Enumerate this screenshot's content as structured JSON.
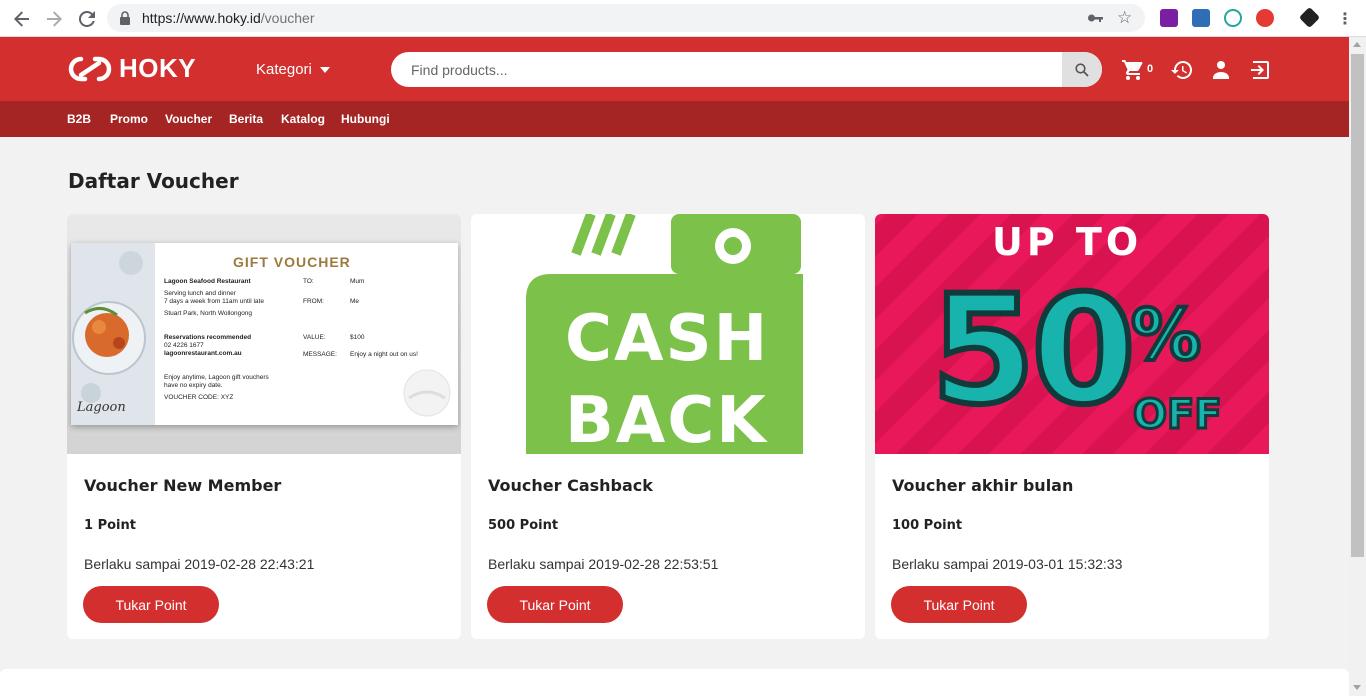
{
  "browser": {
    "url_domain": "https://www.hoky.id",
    "url_path": "/voucher",
    "back_icon": "back-arrow-icon",
    "forward_icon": "forward-arrow-icon",
    "reload_icon": "reload-icon"
  },
  "header": {
    "logo_text": "HOKY",
    "kategori_label": "Kategori",
    "search_placeholder": "Find products...",
    "cart_count": "0",
    "brand_color": "#d32f2f",
    "subnav_color": "#a52525"
  },
  "subnav": {
    "items": [
      "B2B",
      "Promo",
      "Voucher",
      "Berita",
      "Katalog",
      "Hubungi"
    ]
  },
  "main": {
    "page_title": "Daftar Voucher",
    "vouchers": [
      {
        "title": "Voucher New Member",
        "points": "1 Point",
        "validity": "Berlaku sampai 2019-02-28 22:43:21",
        "button_label": "Tukar Point",
        "image": {
          "heading": "GIFT VOUCHER",
          "restaurant": "Lagoon Seafood Restaurant",
          "hours_1": "Serving lunch and dinner",
          "hours_2": "7 days a week from 11am until late",
          "address": "Stuart Park, North Wollongong",
          "reservations": "Reservations recommended",
          "phone": "02 4226 1677",
          "website": "lagoonrestaurant.com.au",
          "note_1": "Enjoy anytime, Lagoon gift vouchers",
          "note_2": "have no expiry date.",
          "code": "VOUCHER CODE: XYZ",
          "to_label": "TO:",
          "to_value": "Mum",
          "from_label": "FROM:",
          "from_value": "Me",
          "value_label": "VALUE:",
          "value_value": "$100",
          "message_label": "MESSAGE:",
          "message_value": "Enjoy a night out on us!",
          "brand": "Lagoon"
        }
      },
      {
        "title": "Voucher Cashback",
        "points": "500 Point",
        "validity": "Berlaku sampai 2019-02-28 22:53:51",
        "button_label": "Tukar Point",
        "image": {
          "line_1": "CASH",
          "line_2": "BACK",
          "color": "#7bc14a"
        }
      },
      {
        "title": "Voucher akhir bulan",
        "points": "100 Point",
        "validity": "Berlaku sampai 2019-03-01 15:32:33",
        "button_label": "Tukar Point",
        "image": {
          "line_1": "UP TO",
          "number": "50",
          "percent": "%",
          "off": "OFF",
          "bg_color": "#e8185a",
          "text_color": "#17b3ac"
        }
      }
    ]
  }
}
